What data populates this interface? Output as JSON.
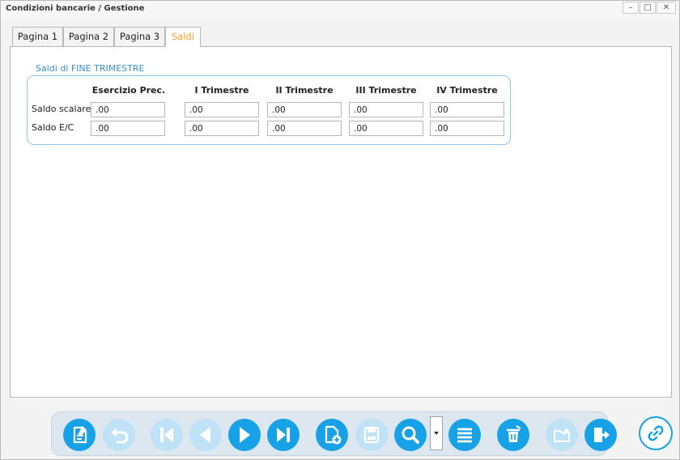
{
  "window": {
    "title": "Condizioni bancarie / Gestione",
    "minimize": "–",
    "maximize": "□",
    "close": "✕"
  },
  "tabs": [
    {
      "label": "Pagina 1"
    },
    {
      "label": "Pagina 2"
    },
    {
      "label": "Pagina 3"
    },
    {
      "label": "Saldi",
      "active": true
    }
  ],
  "group": {
    "title": "Saldi di FINE TRIMESTRE",
    "columns": [
      "Esercizio Prec.",
      "I Trimestre",
      "II Trimestre",
      "III Trimestre",
      "IV Trimestre"
    ],
    "rows": [
      {
        "label": "Saldo scalare",
        "values": [
          ".00",
          ".00",
          ".00",
          ".00",
          ".00"
        ]
      },
      {
        "label": "Saldo E/C",
        "values": [
          ".00",
          ".00",
          ".00",
          ".00",
          ".00"
        ]
      }
    ]
  },
  "toolbar": {
    "buttons": [
      {
        "icon": "edit-document-icon",
        "enabled": true
      },
      {
        "icon": "undo-icon",
        "enabled": false
      },
      {
        "icon": "first-record-icon",
        "enabled": false
      },
      {
        "icon": "previous-record-icon",
        "enabled": false
      },
      {
        "icon": "next-record-icon",
        "enabled": true
      },
      {
        "icon": "last-record-icon",
        "enabled": true
      },
      {
        "icon": "new-document-icon",
        "enabled": true
      },
      {
        "icon": "save-icon",
        "enabled": false
      },
      {
        "icon": "search-icon",
        "enabled": true
      },
      {
        "icon": "list-icon",
        "enabled": true
      },
      {
        "icon": "delete-icon",
        "enabled": true
      },
      {
        "icon": "folder-edit-icon",
        "enabled": false
      },
      {
        "icon": "exit-icon",
        "enabled": true
      }
    ],
    "dropdown_icon": "chevron-down-icon",
    "link_icon": "link-icon"
  },
  "colors": {
    "accent": "#17a1e6",
    "accent_disabled": "#bfe2f6",
    "active_tab": "#f0a030",
    "group_border": "#8cc6ea",
    "group_title": "#3b8fc7"
  }
}
